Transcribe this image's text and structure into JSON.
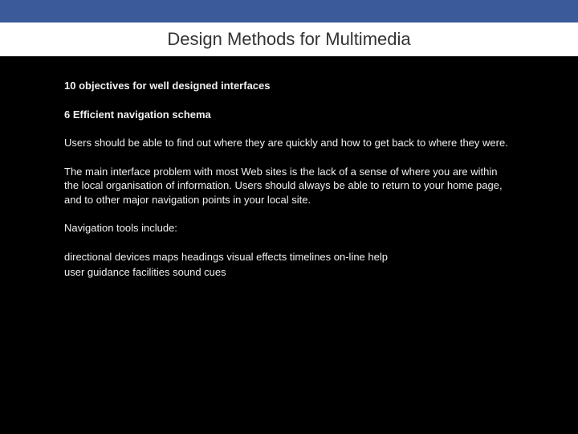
{
  "title": "Design Methods for Multimedia",
  "heading": "10 objectives for well designed interfaces",
  "subheading": "6 Efficient navigation schema",
  "paragraphs": {
    "p1": "Users should be able to find out where they are quickly and how to get back to where they were.",
    "p2": "The main interface problem with most Web sites is the lack of a sense of where you are within the local organisation of information. Users should always be able to return to your home page, and to other major navigation points in your local site.",
    "p3": "Navigation tools include:",
    "tool_line1": "directional devices maps headings visual effects timelines on-line help",
    "tool_line2": "user guidance facilities sound cues"
  }
}
